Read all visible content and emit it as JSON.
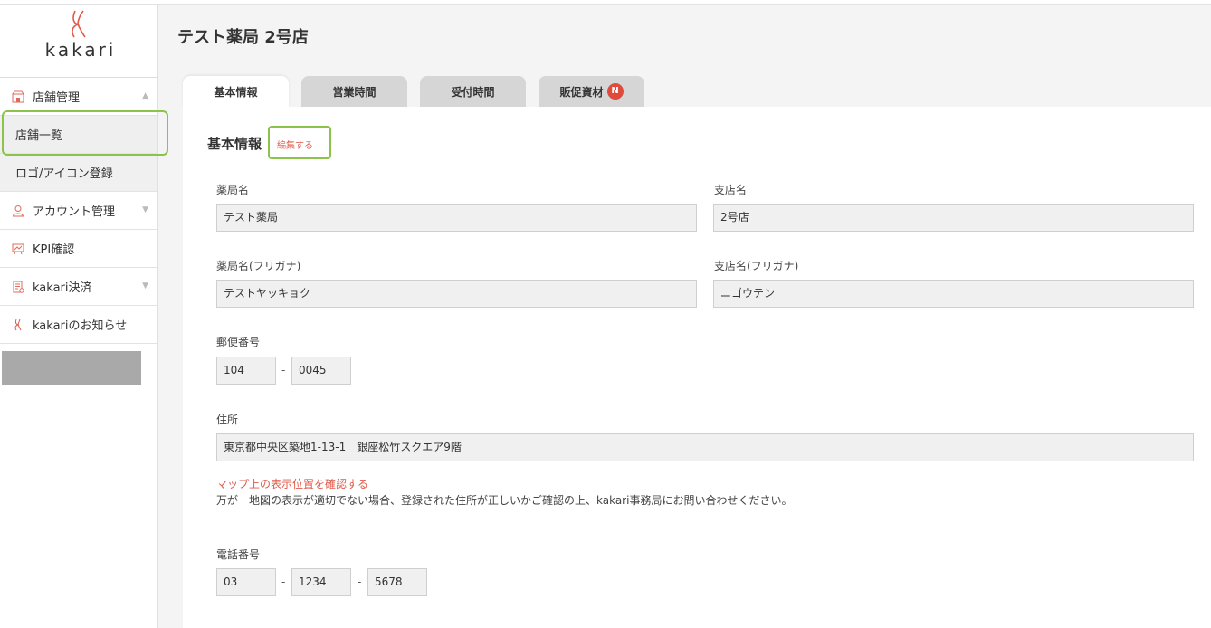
{
  "brand": {
    "logo_text": "kakari"
  },
  "sidebar": {
    "items": [
      {
        "label": "店舗管理",
        "icon": "store-icon"
      },
      {
        "label": "店舗一覧"
      },
      {
        "label": "ロゴ/アイコン登録"
      },
      {
        "label": "アカウント管理",
        "icon": "person-icon"
      },
      {
        "label": "KPI確認",
        "icon": "chart-board-icon"
      },
      {
        "label": "kakari決済",
        "icon": "payment-doc-icon"
      },
      {
        "label": "kakariのお知らせ",
        "icon": "kakari-icon"
      }
    ]
  },
  "page": {
    "title": "テスト薬局 2号店"
  },
  "tabs": [
    {
      "label": "基本情報"
    },
    {
      "label": "営業時間"
    },
    {
      "label": "受付時間"
    },
    {
      "label": "販促資材",
      "badge": "N"
    }
  ],
  "basic": {
    "section_title": "基本情報",
    "edit_label": "編集する",
    "pharmacy_name_label": "薬局名",
    "pharmacy_name": "テスト薬局",
    "branch_name_label": "支店名",
    "branch_name": "2号店",
    "pharmacy_kana_label": "薬局名(フリガナ)",
    "pharmacy_kana": "テストヤッキョク",
    "branch_kana_label": "支店名(フリガナ)",
    "branch_kana": "ニゴウテン",
    "postal_label": "郵便番号",
    "postal_1": "104",
    "postal_2": "0045",
    "address_label": "住所",
    "address": "東京都中央区築地1-13-1　銀座松竹スクエア9階",
    "map_link": "マップ上の表示位置を確認する",
    "map_note": "万が一地図の表示が適切でない場合、登録された住所が正しいかご確認の上、kakari事務局にお問い合わせください。",
    "phone_label": "電話番号",
    "phone_1": "03",
    "phone_2": "1234",
    "phone_3": "5678",
    "dash": "-"
  },
  "colors": {
    "accent": "#e05a4a",
    "highlight": "#8cc34a",
    "tab_inactive": "#d6d6d6"
  }
}
